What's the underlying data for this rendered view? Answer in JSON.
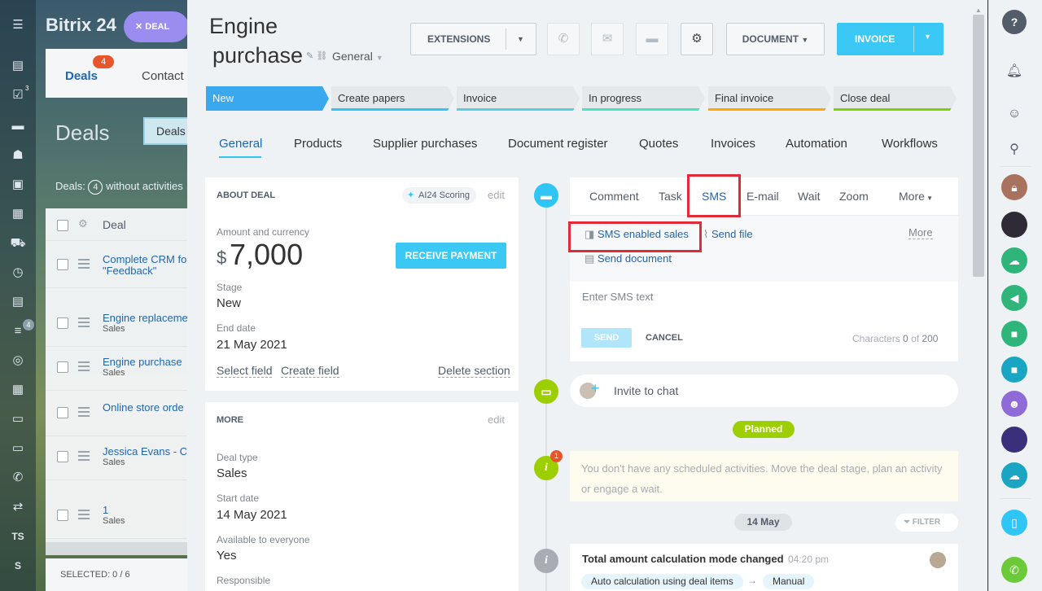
{
  "background": {
    "logo": "Bitrix 24",
    "deal_pill": "DEAL",
    "tabs": [
      {
        "label": "Deals",
        "badge": "4"
      },
      {
        "label": "Contact"
      }
    ],
    "title": "Deals",
    "button": "Deals",
    "counter_text": "Deals:",
    "counter_badge": "4",
    "counter_suffix": "without activities",
    "header_col": "Deal",
    "rows": [
      {
        "title": "Complete CRM for",
        "sub": "\"Feedback\""
      },
      {
        "title": "Engine replaceme",
        "sub": "Sales"
      },
      {
        "title": "Engine purchase",
        "sub": "Sales"
      },
      {
        "title": "Online store orde",
        "sub": ""
      },
      {
        "title": "Jessica Evans - C",
        "sub": "Sales"
      },
      {
        "title": "1",
        "sub": "Sales"
      }
    ],
    "footer": "SELECTED: 0 / 6",
    "nav_badges": [
      "3",
      "4"
    ],
    "nav_initials": [
      "TS",
      "S"
    ]
  },
  "header": {
    "title_line1": "Engine",
    "title_line2": "purchase",
    "category": "General",
    "extensions_label": "EXTENSIONS",
    "document_label": "DOCUMENT",
    "invoice_label": "INVOICE"
  },
  "stages": [
    {
      "label": "New",
      "color": "#39a8ef"
    },
    {
      "label": "Create papers",
      "color": "#2fc6f6"
    },
    {
      "label": "Invoice",
      "color": "#55d0e0"
    },
    {
      "label": "In progress",
      "color": "#47e4c2"
    },
    {
      "label": "Final invoice",
      "color": "#ffa900"
    },
    {
      "label": "Close deal",
      "color": "#7bd500"
    }
  ],
  "tabs": [
    "General",
    "Products",
    "Supplier purchases",
    "Document register",
    "Quotes",
    "Invoices",
    "Automation",
    "Workflows"
  ],
  "about": {
    "title": "ABOUT DEAL",
    "scoring": "AI24 Scoring",
    "edit": "edit",
    "amount_label": "Amount and currency",
    "currency": "$",
    "amount": "7,000",
    "receive_payment": "RECEIVE PAYMENT",
    "stage_label": "Stage",
    "stage_value": "New",
    "end_label": "End date",
    "end_value": "21 May 2021",
    "select_field": "Select field",
    "create_field": "Create field",
    "delete_section": "Delete section"
  },
  "more": {
    "title": "MORE",
    "edit": "edit",
    "deal_type_label": "Deal type",
    "deal_type_value": "Sales",
    "start_label": "Start date",
    "start_value": "14 May 2021",
    "avail_label": "Available to everyone",
    "avail_value": "Yes",
    "resp_label": "Responsible"
  },
  "activity": {
    "tabs": [
      "Comment",
      "Task",
      "SMS",
      "E-mail",
      "Wait",
      "Zoom",
      "More"
    ],
    "sms_enabled_sales": "SMS enabled sales",
    "send_file": "Send file",
    "more_link": "More",
    "send_document": "Send document",
    "sms_placeholder": "Enter SMS text",
    "send": "SEND",
    "cancel": "CANCEL",
    "chars_label": "Characters",
    "chars_used": "0",
    "chars_of": "of",
    "chars_max": "200"
  },
  "timeline": {
    "invite": "Invite to chat",
    "planned": "Planned",
    "notice_badge": "1",
    "notice_text": "You don't have any scheduled activities. Move the deal stage, plan an activity or engage a wait.",
    "date_chip": "14 May",
    "filter": "FILTER",
    "event_title": "Total amount calculation mode changed",
    "event_time": "04:20 pm",
    "event_from": "Auto calculation using deal items",
    "event_to": "Manual"
  },
  "right_bar": {
    "circle_colors": [
      "#a8725e",
      "#2f2a35",
      "#2fb47a",
      "#2fb47a",
      "#2fb47a",
      "#1aa6c2",
      "#8e6bd6",
      "#3a2f7a",
      "#1aa6c2",
      "#2fc6f6",
      "#6cc93a"
    ]
  }
}
